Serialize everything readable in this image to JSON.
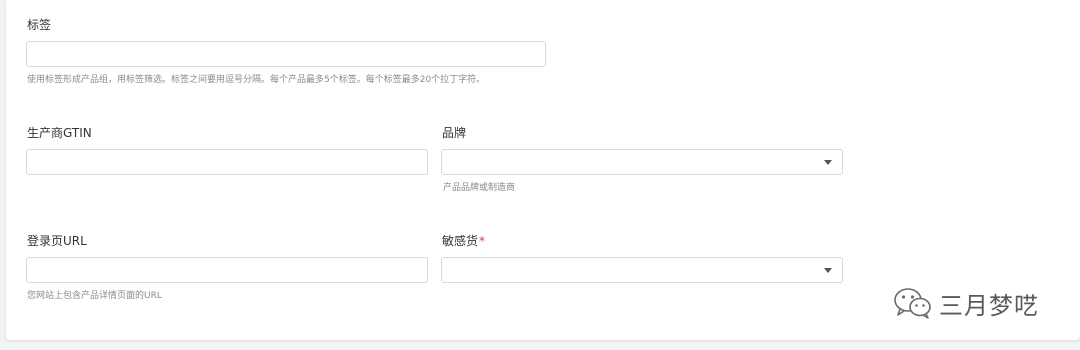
{
  "fields": {
    "tags": {
      "label": "标签",
      "value": "",
      "hint": "使用标签形成产品组，用标签筛选。标签之间要用逗号分隔。每个产品最多5个标签。每个标签最多20个拉丁字符。"
    },
    "gtin": {
      "label": "生产商GTIN",
      "value": ""
    },
    "brand": {
      "label": "品牌",
      "value": "",
      "hint": "产品品牌或制造商"
    },
    "landing_url": {
      "label": "登录页URL",
      "value": "",
      "hint": "您网站上包含产品详情页面的URL"
    },
    "sensitive_goods": {
      "label": "敏感货",
      "required_mark": "*",
      "value": ""
    }
  },
  "watermark": {
    "text": "三月梦呓",
    "icon": "wechat-icon"
  },
  "colors": {
    "required": "#e4393c",
    "border": "#d9d9d9",
    "hint": "#8a8a8a"
  }
}
